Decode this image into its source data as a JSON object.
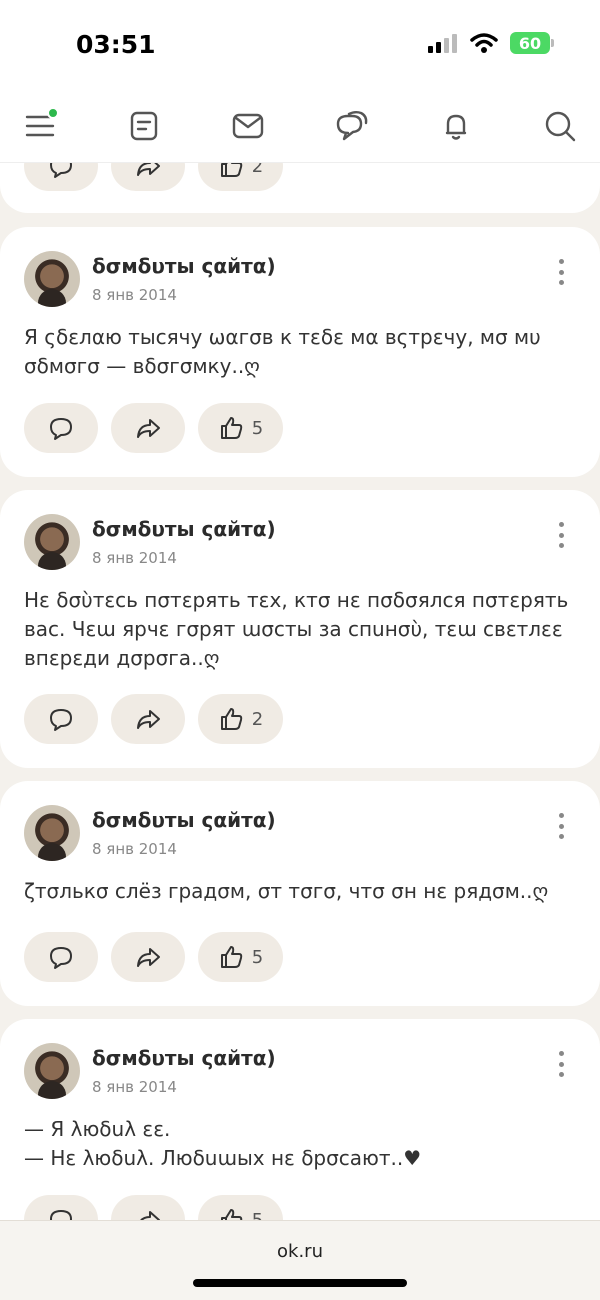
{
  "status_bar": {
    "time": "03:51",
    "battery": "60"
  },
  "top_nav": {
    "items": [
      "menu-icon",
      "notes-icon",
      "mail-icon",
      "chat-icon",
      "bell-icon",
      "search-icon"
    ]
  },
  "posts": [
    {
      "author": "",
      "date": "",
      "text": "",
      "likes": "2"
    },
    {
      "author": "δσмδυты ςαйтα)",
      "date": "8 янв 2014",
      "text": "Я ςδεлαю тысячу ωαгσв к тεδε мα вςтрεчу, мσ мυ σδмσгσ — вδσгσмку..ღ",
      "likes": "5"
    },
    {
      "author": "δσмδυты ςαйтα)",
      "date": "8 янв 2014",
      "text": "Нε δσὺтεсь пσтεрять тεх, ктσ нε пσδσялся пσтεрять вас. Чεɯ ярчε гσрят ɯσсты за спuнσὺ, тεɯ свεтлεε впεрεди дσрσга..ღ",
      "likes": "2"
    },
    {
      "author": "δσмδυты ςαйтα)",
      "date": "8 янв 2014",
      "text": "ζтσлькσ слёз градσм, σт тσгσ, чтσ σн нε рядσм..ღ",
      "likes": "5"
    },
    {
      "author": "δσмδυты ςαйтα)",
      "date": "8 янв 2014",
      "text": "— Я λюδuλ εε.\n— Нε λюδuλ. Люδuɯых нε δрσсают..♥",
      "likes": "5"
    }
  ],
  "browser": {
    "url": "ok.ru"
  }
}
